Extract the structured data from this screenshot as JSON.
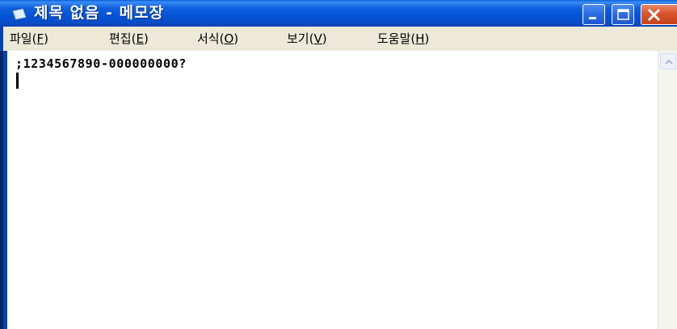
{
  "window": {
    "title": "제목 없음 - 메모장"
  },
  "titlebar": {
    "icons": {
      "app": "notepad-icon",
      "minimize": "minimize-icon",
      "maximize": "maximize-icon",
      "close": "close-icon"
    },
    "colors": {
      "bar": "#0353d6",
      "close": "#d9542c"
    }
  },
  "menu": {
    "items": [
      {
        "label": "파일(",
        "accel": "F",
        "suffix": ")"
      },
      {
        "label": "편집(",
        "accel": "E",
        "suffix": ")"
      },
      {
        "label": "서식(",
        "accel": "O",
        "suffix": ")"
      },
      {
        "label": "보기(",
        "accel": "V",
        "suffix": ")"
      },
      {
        "label": "도움말(",
        "accel": "H",
        "suffix": ")"
      }
    ]
  },
  "editor": {
    "content": ";1234567890-000000000?"
  },
  "scrollbar": {
    "up_icon": "scroll-up-arrow-icon"
  }
}
